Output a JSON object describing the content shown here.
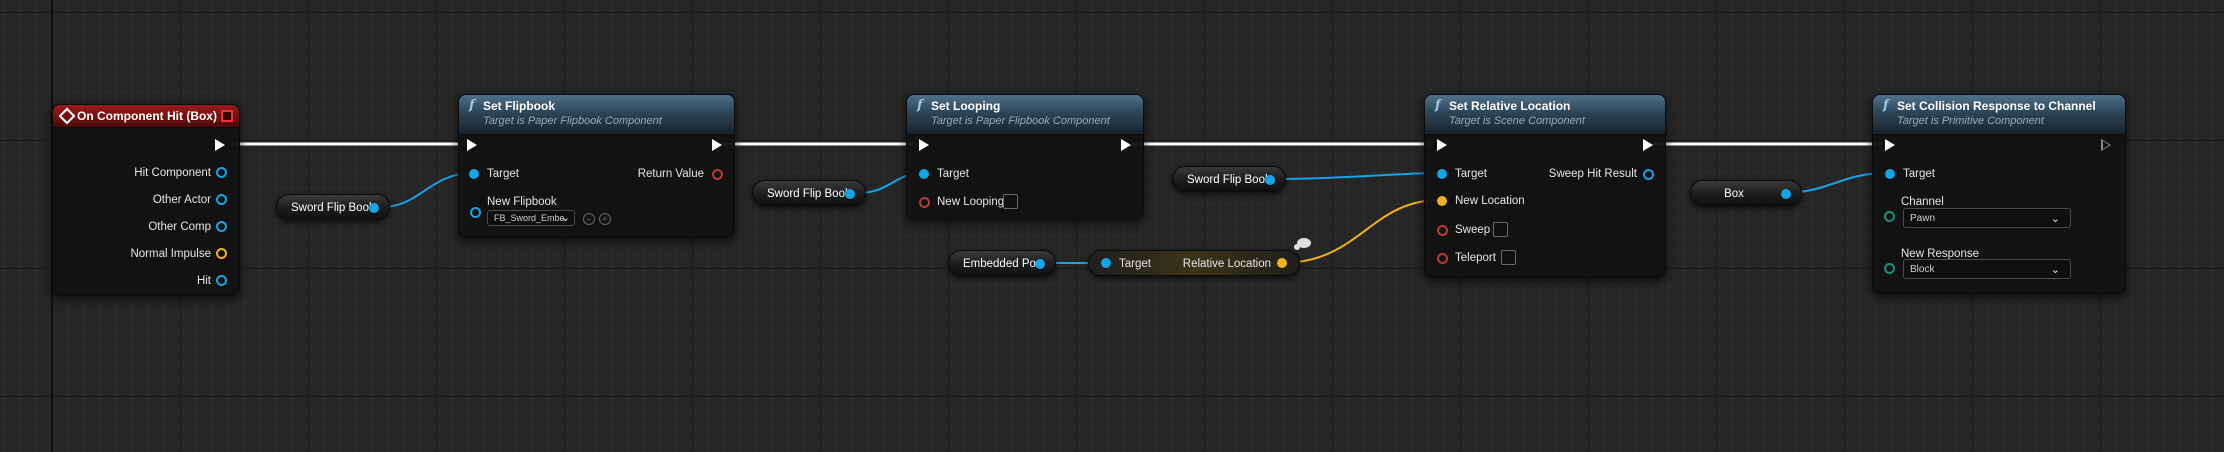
{
  "nodes": {
    "on_hit": {
      "title": "On Component Hit (Box)",
      "outputs": [
        "Hit Component",
        "Other Actor",
        "Other Comp",
        "Normal Impulse",
        "Hit"
      ]
    },
    "set_flipbook": {
      "title": "Set Flipbook",
      "subtitle": "Target is Paper Flipbook Component",
      "target_label": "Target",
      "return_label": "Return Value",
      "new_flipbook_label": "New Flipbook",
      "new_flipbook_value": "FB_Sword_Embe"
    },
    "set_looping": {
      "title": "Set Looping",
      "subtitle": "Target is Paper Flipbook Component",
      "target_label": "Target",
      "new_looping_label": "New Looping"
    },
    "set_rel_loc": {
      "title": "Set Relative Location",
      "subtitle": "Target is Scene Component",
      "target_label": "Target",
      "sweep_result_label": "Sweep Hit Result",
      "new_location_label": "New Location",
      "sweep_label": "Sweep",
      "teleport_label": "Teleport"
    },
    "set_collision": {
      "title": "Set Collision Response to Channel",
      "subtitle": "Target is Primitive Component",
      "target_label": "Target",
      "channel_label": "Channel",
      "channel_value": "Pawn",
      "new_response_label": "New Response",
      "new_response_value": "Block"
    },
    "rel_loc_getter": {
      "target_label": "Target",
      "output_label": "Relative Location"
    }
  },
  "variables": {
    "sword_flip_book_1": "Sword Flip Book",
    "sword_flip_book_2": "Sword Flip Book",
    "sword_flip_book_3": "Sword Flip Book",
    "embedded_pos": "Embedded Pos",
    "box": "Box"
  },
  "colors": {
    "exec": "#ffffff",
    "object": "#14a4e8",
    "vector": "#f0b21a",
    "bool": "#c0392b",
    "struct": "#1b8f7a",
    "event_header": "#9a1c1c",
    "function_header": "#2c4557"
  }
}
